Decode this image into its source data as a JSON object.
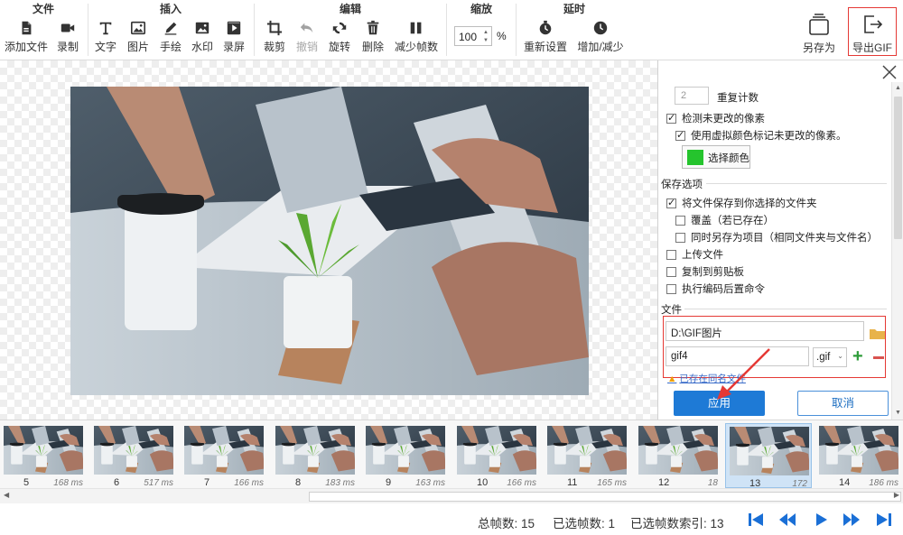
{
  "ribbon": {
    "groups": [
      {
        "title": "文件"
      },
      {
        "title": "插入"
      },
      {
        "title": "编辑"
      },
      {
        "title": "缩放"
      },
      {
        "title": "延时"
      }
    ],
    "buttons": {
      "add_file": "添加文件",
      "record": "录制",
      "text": "文字",
      "image": "图片",
      "draw": "手绘",
      "watermark": "水印",
      "screen_record": "录屏",
      "crop": "裁剪",
      "undo": "撤销",
      "rotate": "旋转",
      "delete": "删除",
      "reduce_frames": "减少帧数",
      "reset": "重新设置",
      "increase_decrease": "增加/减少",
      "save_as": "另存为",
      "export_gif": "导出GIF"
    },
    "zoom": {
      "value": "100",
      "unit": "%"
    }
  },
  "panel": {
    "repeat_count_value": "2",
    "repeat_count_label": "重复计数",
    "detect_unchanged": "检测未更改的像素",
    "use_virtual_color": "使用虚拟颜色标记未更改的像素。",
    "choose_color": "选择颜色",
    "color_value": "#25c42d",
    "save_options_title": "保存选项",
    "save_to_folder": "将文件保存到你选择的文件夹",
    "overwrite": "覆盖（若已存在）",
    "save_as_project": "同时另存为项目（相同文件夹与文件名）",
    "upload_file": "上传文件",
    "copy_clipboard": "复制到剪贴板",
    "run_post_command": "执行编码后置命令",
    "file_title": "文件",
    "folder_path": "D:\\GIF图片",
    "file_name": "gif4",
    "extension": ".gif",
    "warning": "已存在同名文件",
    "apply": "应用",
    "cancel": "取消"
  },
  "timeline": {
    "frames": [
      {
        "num": "5",
        "ms": "168 ms"
      },
      {
        "num": "6",
        "ms": "517 ms"
      },
      {
        "num": "7",
        "ms": "166 ms"
      },
      {
        "num": "8",
        "ms": "183 ms"
      },
      {
        "num": "9",
        "ms": "163 ms"
      },
      {
        "num": "10",
        "ms": "166 ms"
      },
      {
        "num": "11",
        "ms": "165 ms"
      },
      {
        "num": "12",
        "ms": "18"
      },
      {
        "num": "13",
        "ms": "172"
      },
      {
        "num": "14",
        "ms": "186 ms"
      }
    ]
  },
  "status": {
    "total_frames": "总帧数: 15",
    "selected_frames": "已选帧数: 1",
    "selected_index": "已选帧数索引: 13"
  },
  "colors": {
    "accent": "#1e7ad6",
    "highlight_red": "#e53935",
    "nav_blue": "#1a6fd6"
  }
}
